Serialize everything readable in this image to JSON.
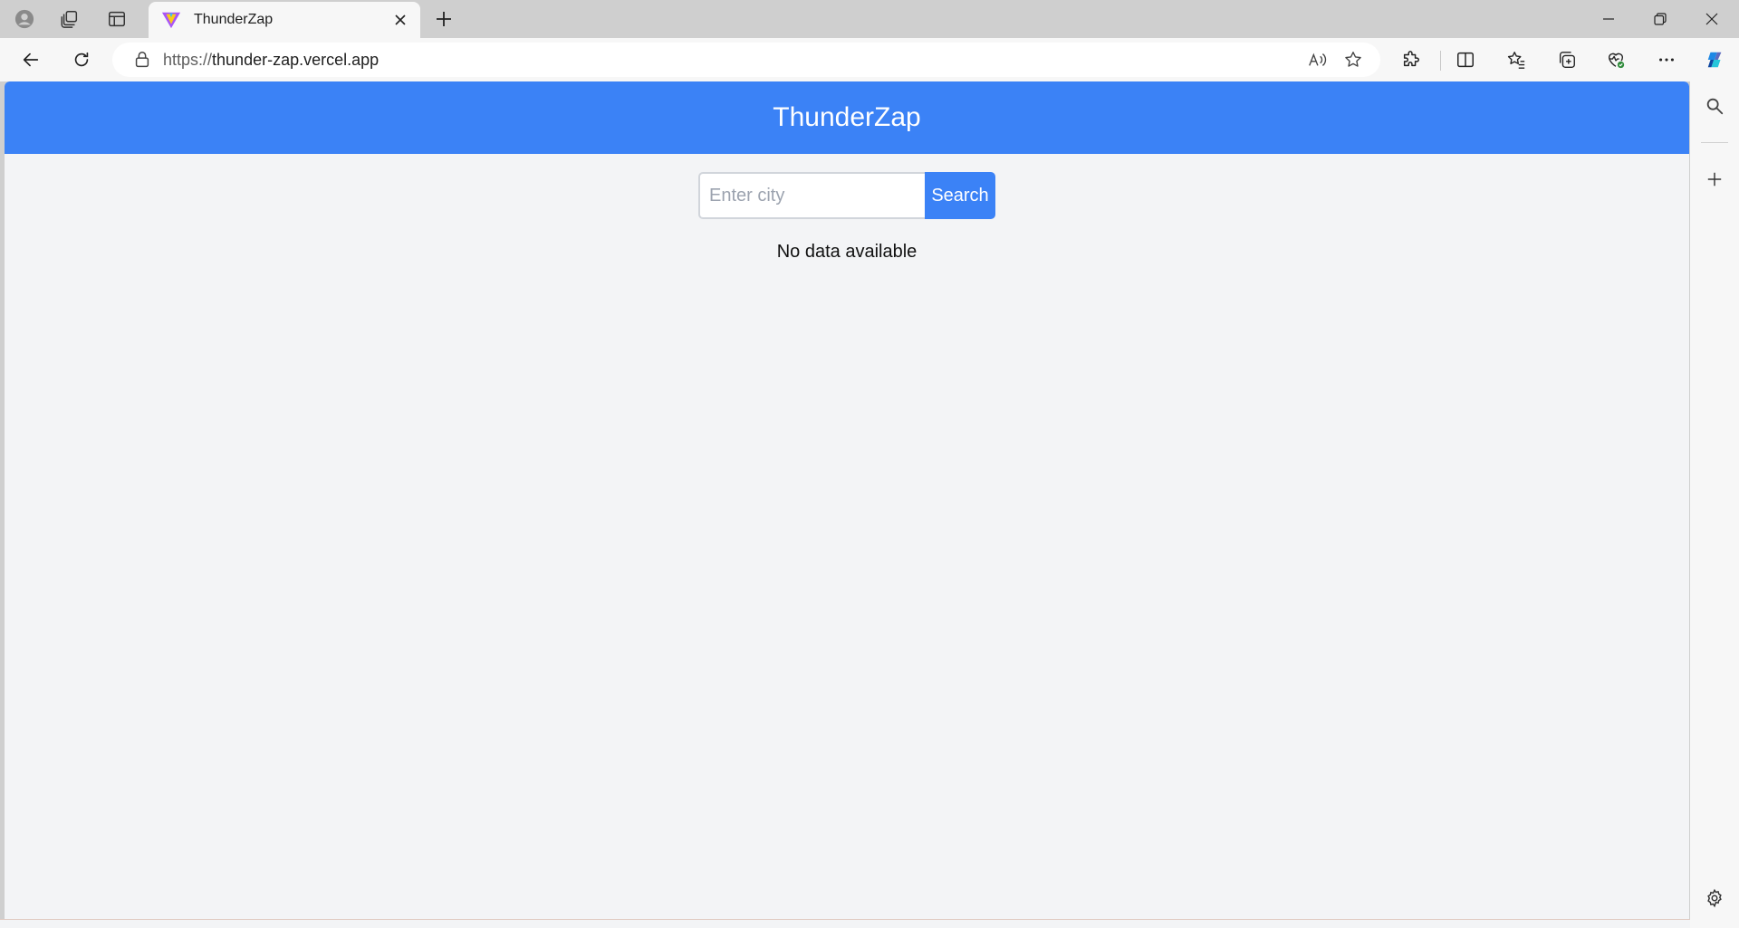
{
  "browser": {
    "tab": {
      "title": "ThunderZap"
    },
    "address_bar": {
      "scheme": "https://",
      "host": "thunder-zap.vercel.app"
    }
  },
  "app": {
    "title": "ThunderZap",
    "search": {
      "placeholder": "Enter city",
      "value": "",
      "button_label": "Search"
    },
    "status_message": "No data available"
  },
  "colors": {
    "header_bg": "#3b82f6",
    "button_bg": "#3b82f6",
    "page_bg": "#f3f4f6"
  }
}
